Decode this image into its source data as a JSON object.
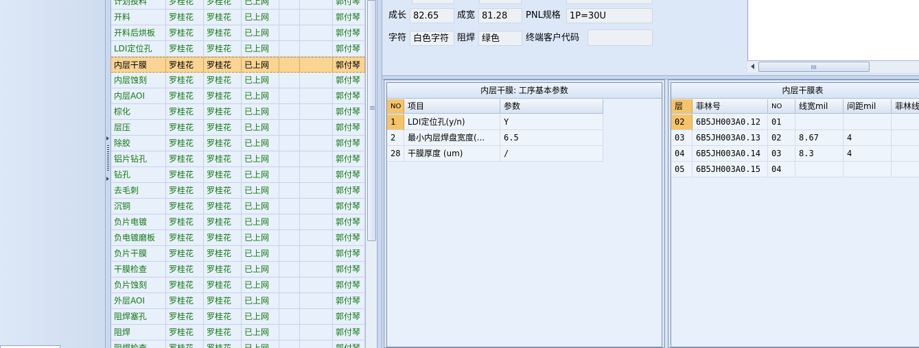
{
  "process_list": {
    "rows": [
      {
        "name": "计划投料",
        "c1": "罗桂花",
        "c2": "罗桂花",
        "status": "已上网",
        "person": "郭付琴"
      },
      {
        "name": "开料",
        "c1": "罗桂花",
        "c2": "罗桂花",
        "status": "已上网",
        "person": "郭付琴"
      },
      {
        "name": "开料后烘板",
        "c1": "罗桂花",
        "c2": "罗桂花",
        "status": "已上网",
        "person": "郭付琴"
      },
      {
        "name": "LDI定位孔",
        "c1": "罗桂花",
        "c2": "罗桂花",
        "status": "已上网",
        "person": "郭付琴"
      },
      {
        "name": "内层干膜",
        "c1": "罗桂花",
        "c2": "罗桂花",
        "status": "已上网",
        "person": "郭付琴",
        "selected": true
      },
      {
        "name": "内层蚀刻",
        "c1": "罗桂花",
        "c2": "罗桂花",
        "status": "已上网",
        "person": "郭付琴"
      },
      {
        "name": "内层AOI",
        "c1": "罗桂花",
        "c2": "罗桂花",
        "status": "已上网",
        "person": "郭付琴"
      },
      {
        "name": "棕化",
        "c1": "罗桂花",
        "c2": "罗桂花",
        "status": "已上网",
        "person": "郭付琴"
      },
      {
        "name": "层压",
        "c1": "罗桂花",
        "c2": "罗桂花",
        "status": "已上网",
        "person": "郭付琴"
      },
      {
        "name": "除胶",
        "c1": "罗桂花",
        "c2": "罗桂花",
        "status": "已上网",
        "person": "郭付琴"
      },
      {
        "name": "铝片钻孔",
        "c1": "罗桂花",
        "c2": "罗桂花",
        "status": "已上网",
        "person": "郭付琴"
      },
      {
        "name": "钻孔",
        "c1": "罗桂花",
        "c2": "罗桂花",
        "status": "已上网",
        "person": "郭付琴"
      },
      {
        "name": "去毛刺",
        "c1": "罗桂花",
        "c2": "罗桂花",
        "status": "已上网",
        "person": "郭付琴"
      },
      {
        "name": "沉铜",
        "c1": "罗桂花",
        "c2": "罗桂花",
        "status": "已上网",
        "person": "郭付琴"
      },
      {
        "name": "负片电镀",
        "c1": "罗桂花",
        "c2": "罗桂花",
        "status": "已上网",
        "person": "郭付琴"
      },
      {
        "name": "负电镀磨板",
        "c1": "罗桂花",
        "c2": "罗桂花",
        "status": "已上网",
        "person": "郭付琴"
      },
      {
        "name": "负片干膜",
        "c1": "罗桂花",
        "c2": "罗桂花",
        "status": "已上网",
        "person": "郭付琴"
      },
      {
        "name": "干膜检查",
        "c1": "罗桂花",
        "c2": "罗桂花",
        "status": "已上网",
        "person": "郭付琴"
      },
      {
        "name": "负片蚀刻",
        "c1": "罗桂花",
        "c2": "罗桂花",
        "status": "已上网",
        "person": "郭付琴"
      },
      {
        "name": "外层AOI",
        "c1": "罗桂花",
        "c2": "罗桂花",
        "status": "已上网",
        "person": "郭付琴"
      },
      {
        "name": "阻焊塞孔",
        "c1": "罗桂花",
        "c2": "罗桂花",
        "status": "已上网",
        "person": "郭付琴"
      },
      {
        "name": "阻焊",
        "c1": "罗桂花",
        "c2": "罗桂花",
        "status": "已上网",
        "person": "郭付琴"
      },
      {
        "name": "阻焊检查",
        "c1": "罗桂花",
        "c2": "罗桂花",
        "status": "已上网",
        "person": "郭付琴"
      }
    ]
  },
  "info": {
    "growth_label": "成长",
    "growth_value": "82.65",
    "width_label": "成宽",
    "width_value": "81.28",
    "pnl_label": "PNL规格",
    "pnl_value": "1P=30U",
    "char_label": "字符",
    "char_value": "白色字符",
    "mask_label": "阻焊",
    "mask_value": "绿色",
    "customer_label": "终端客户代码",
    "customer_value": ""
  },
  "params_panel": {
    "title": "内层干膜: 工序基本参数",
    "headers": {
      "no": "NO",
      "item": "项目",
      "param": "参数"
    },
    "rows": [
      {
        "no": "1",
        "item": "LDI定位孔(y/n)",
        "param": "Y"
      },
      {
        "no": "2",
        "item": "最小内层焊盘宽度(...",
        "param": "6.5"
      },
      {
        "no": "28",
        "item": "干膜厚度 (um)",
        "param": "/"
      }
    ]
  },
  "film_panel": {
    "title": "内层干膜表",
    "headers": {
      "layer": "层",
      "film": "菲林号",
      "no": "NO",
      "line_width": "线宽mil",
      "spacing": "间距mil",
      "film_line": "菲林线"
    },
    "rows": [
      {
        "layer": "02",
        "film": "6B5JH003A0.12",
        "no": "01",
        "line_width": "",
        "spacing": ""
      },
      {
        "layer": "03",
        "film": "6B5JH003A0.13",
        "no": "02",
        "line_width": "8.67",
        "spacing": "4"
      },
      {
        "layer": "04",
        "film": "6B5JH003A0.14",
        "no": "03",
        "line_width": "8.3",
        "spacing": "4"
      },
      {
        "layer": "05",
        "film": "6B5JH003A0.15",
        "no": "04",
        "line_width": "",
        "spacing": ""
      }
    ]
  },
  "colors": {
    "text_green": "#137a13",
    "selection": "#f9d493",
    "header_active": "#f5c46a",
    "background": "#dbe6f5"
  }
}
